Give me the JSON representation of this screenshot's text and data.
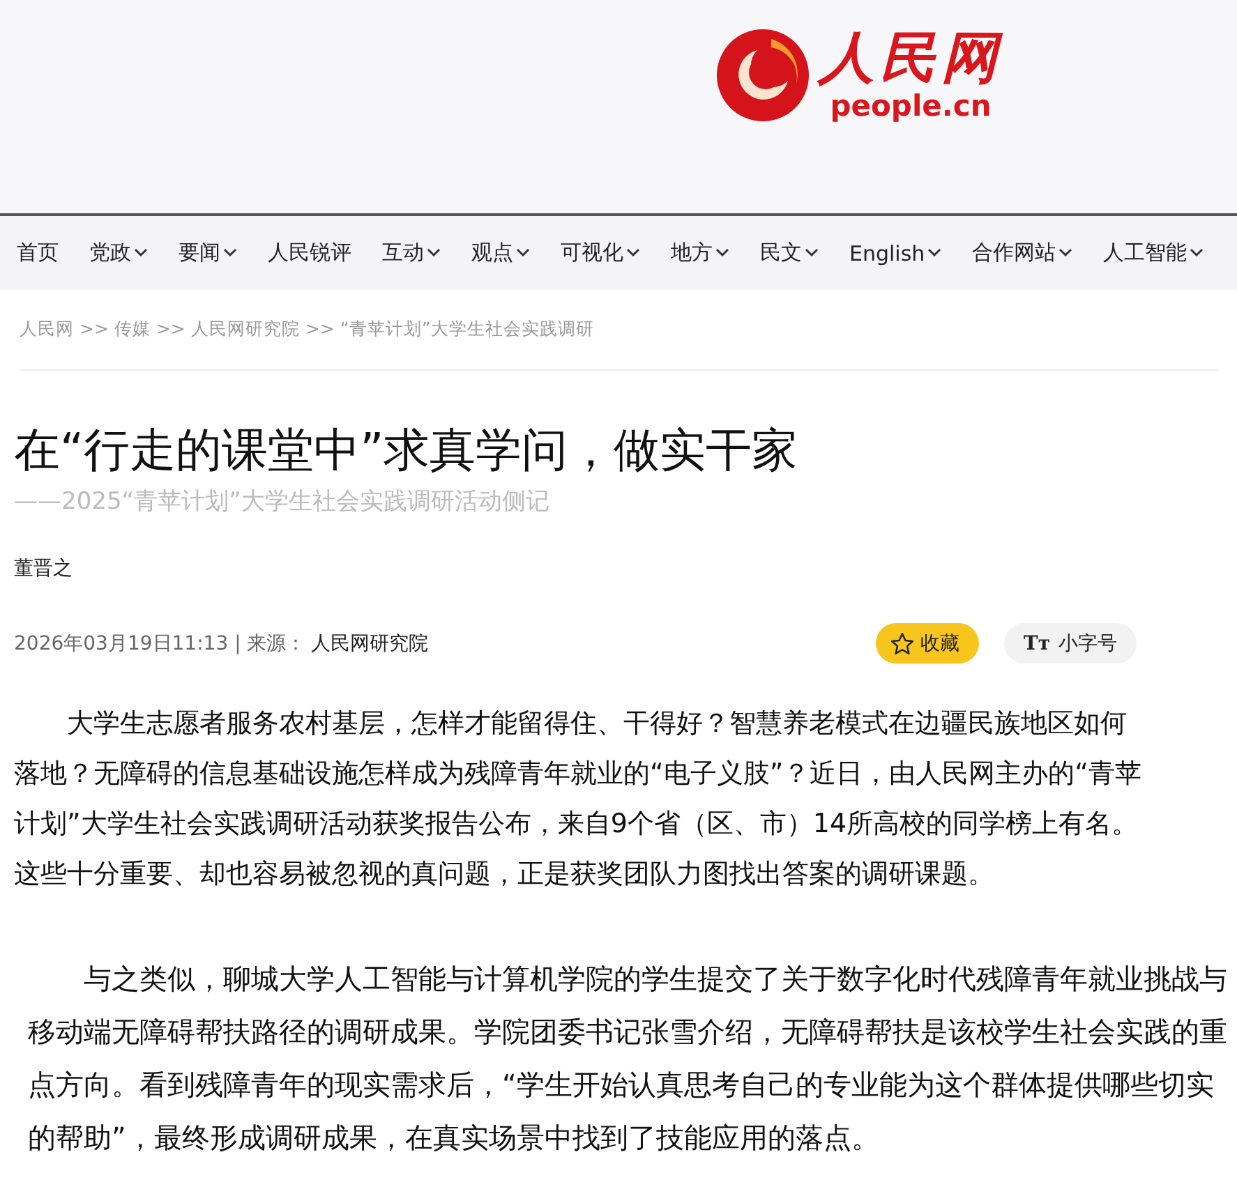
{
  "logo": {
    "name": "人民网",
    "domain": "people.cn"
  },
  "nav": [
    {
      "label": "首页",
      "dropdown": false
    },
    {
      "label": "党政",
      "dropdown": true
    },
    {
      "label": "要闻",
      "dropdown": true
    },
    {
      "label": "人民锐评",
      "dropdown": false
    },
    {
      "label": "互动",
      "dropdown": true
    },
    {
      "label": "观点",
      "dropdown": true
    },
    {
      "label": "可视化",
      "dropdown": true
    },
    {
      "label": "地方",
      "dropdown": true
    },
    {
      "label": "民文",
      "dropdown": true
    },
    {
      "label": "English",
      "dropdown": true
    },
    {
      "label": "合作网站",
      "dropdown": true
    },
    {
      "label": "人工智能",
      "dropdown": true
    }
  ],
  "breadcrumbs": [
    "人民网",
    "传媒",
    "人民网研究院",
    "“青苹计划”大学生社会实践调研"
  ],
  "breadcrumb_separator": ">>",
  "article": {
    "title": "在“行走的课堂中”求真学问，做实干家",
    "subtitle": "——2025“青苹计划”大学生社会实践调研活动侧记",
    "author": "董晋之",
    "datetime": "2026年03月19日11:13",
    "source_label": "| 来源：",
    "source": "人民网研究院",
    "favorite_button": "收藏",
    "font_button": {
      "glyph": "Tт",
      "label": "小字号"
    },
    "paragraphs": [
      {
        "indent": true,
        "text": "大学生志愿者服务农村基层，怎样才能留得住、干得好？智慧养老模式在边疆民族地区如何落地？无障碍的信息基础设施怎样成为残障青年就业的“电子义肢”？近日，由人民网主办的“青苹计划”大学生社会实践调研活动获奖报告公布，来自9个省（区、市）14所高校的同学榜上有名。"
      },
      {
        "indent": false,
        "text": "这些十分重要、却也容易被忽视的真问题，正是获奖团队力图找出答案的调研课题。"
      },
      {
        "indent": true,
        "text": "与之类似，聊城大学人工智能与计算机学院的学生提交了关于数字化时代残障青年就业挑战与移动端无障碍帮扶路径的调研成果。学院团委书记张雪介绍，无障碍帮扶是该校学生社会实践的重点方向。看到残障青年的现实需求后，“学生开始认真思考自己的专业能为这个群体提供哪些切实的帮助”，最终形成调研成果，在真实场景中找到了技能应用的落点。"
      }
    ]
  }
}
